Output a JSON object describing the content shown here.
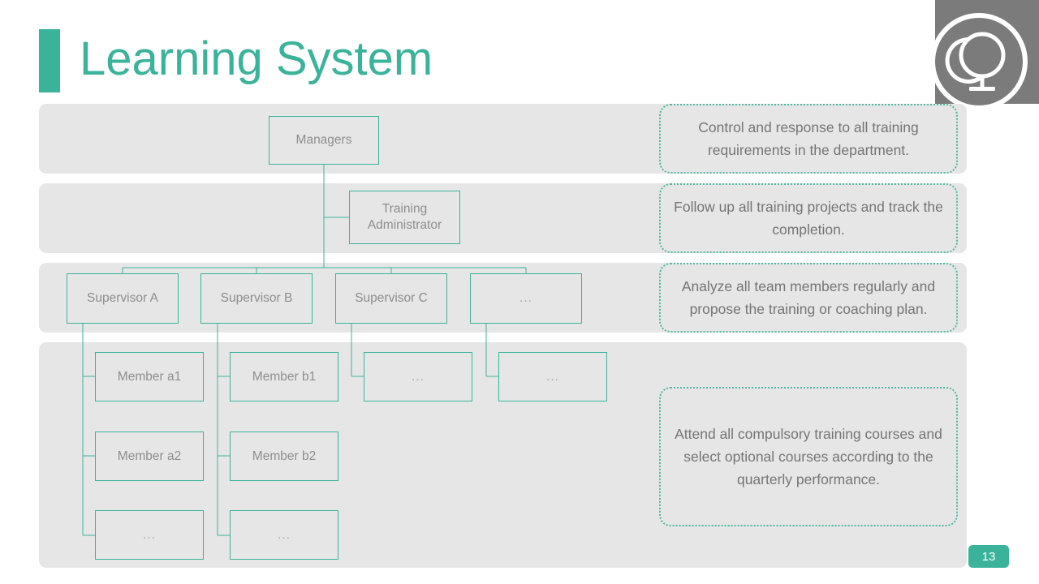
{
  "slide": {
    "title": "Learning System",
    "page_number": "13",
    "accent_color": "#3bb39b",
    "band_color": "#e6e6e6",
    "logo_icon": "globe-icon"
  },
  "org_chart": {
    "managers": "Managers",
    "training_administrator": "Training Administrator",
    "supervisors": [
      {
        "label": "Supervisor A"
      },
      {
        "label": "Supervisor B"
      },
      {
        "label": "Supervisor C"
      },
      {
        "label": "..."
      }
    ],
    "members": {
      "a": [
        "Member a1",
        "Member a2",
        "..."
      ],
      "b": [
        "Member b1",
        "Member b2",
        "..."
      ],
      "c": [
        "..."
      ],
      "d": [
        "..."
      ]
    }
  },
  "callouts": [
    {
      "text": "Control and response to all training requirements in the department."
    },
    {
      "text": "Follow up all training projects and track the completion."
    },
    {
      "text": "Analyze all team members regularly and propose the training or coaching plan."
    },
    {
      "text": "Attend all compulsory training courses and select optional courses according to the quarterly performance."
    }
  ]
}
